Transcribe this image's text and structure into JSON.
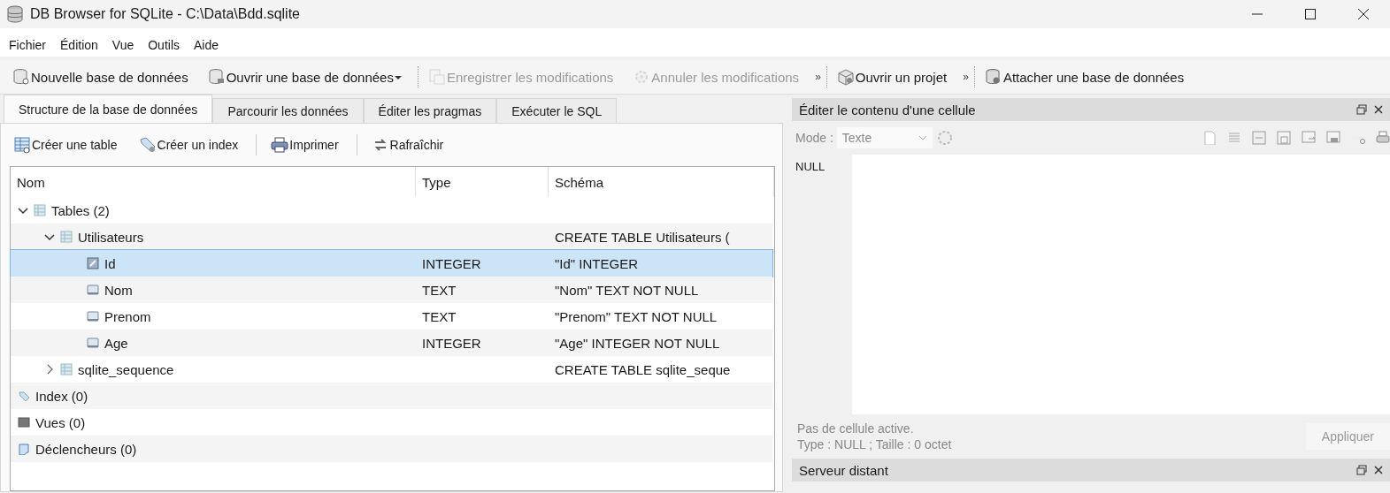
{
  "window": {
    "title": "DB Browser for SQLite - C:\\Data\\Bdd.sqlite"
  },
  "menu": [
    "Fichier",
    "Édition",
    "Vue",
    "Outils",
    "Aide"
  ],
  "toolbar": [
    {
      "kind": "button",
      "label": "Nouvelle base de données",
      "disabled": false
    },
    {
      "kind": "button",
      "label": "Ouvrir une base de données",
      "disabled": false,
      "dropdown": true
    },
    {
      "kind": "button",
      "label": "Enregistrer les modifications",
      "disabled": true
    },
    {
      "kind": "button",
      "label": "Annuler les modifications",
      "disabled": true
    },
    {
      "kind": "overflow",
      "label": "»"
    },
    {
      "kind": "button",
      "label": "Ouvrir un projet",
      "disabled": false
    },
    {
      "kind": "overflow",
      "label": "»"
    },
    {
      "kind": "button",
      "label": "Attacher une base de données",
      "disabled": false
    }
  ],
  "tabs": [
    {
      "label": "Structure de la base de données",
      "selected": true
    },
    {
      "label": "Parcourir les données",
      "selected": false
    },
    {
      "label": "Éditer les pragmas",
      "selected": false
    },
    {
      "label": "Exécuter le SQL",
      "selected": false
    }
  ],
  "structure_toolbar": [
    {
      "label": "Créer une table"
    },
    {
      "label": "Créer un index"
    },
    {
      "label": "Imprimer"
    },
    {
      "label": "Rafraîchir"
    }
  ],
  "tree": {
    "columns": [
      "Nom",
      "Type",
      "Schéma"
    ],
    "rows": [
      {
        "kind": "group",
        "name": "Tables (2)",
        "expanded": true,
        "selected": false,
        "children": [
          {
            "kind": "table",
            "name": "Utilisateurs",
            "schema": "CREATE TABLE Utilisateurs (",
            "expanded": true,
            "selected": false,
            "children": [
              {
                "kind": "key",
                "name": "Id",
                "type": "INTEGER",
                "schema": "\"Id\" INTEGER",
                "selected": true
              },
              {
                "kind": "field",
                "name": "Nom",
                "type": "TEXT",
                "schema": "\"Nom\" TEXT NOT NULL",
                "selected": false
              },
              {
                "kind": "field",
                "name": "Prenom",
                "type": "TEXT",
                "schema": "\"Prenom\" TEXT NOT NULL",
                "selected": false
              },
              {
                "kind": "field",
                "name": "Age",
                "type": "INTEGER",
                "schema": "\"Age\" INTEGER NOT NULL",
                "selected": false
              }
            ]
          },
          {
            "kind": "table",
            "name": "sqlite_sequence",
            "schema": "CREATE TABLE sqlite_seque",
            "expanded": false,
            "selected": false
          }
        ]
      },
      {
        "kind": "index",
        "name": "Index (0)",
        "selected": false
      },
      {
        "kind": "view",
        "name": "Vues (0)",
        "selected": false
      },
      {
        "kind": "trigger",
        "name": "Déclencheurs (0)",
        "selected": false
      }
    ]
  },
  "cell_editor": {
    "title": "Éditer le contenu d'une cellule",
    "mode_label": "Mode :",
    "mode": "Texte",
    "null_label": "NULL",
    "status": "Pas de cellule active.",
    "info": "Type : NULL ; Taille : 0 octet",
    "apply": "Appliquer",
    "apply_disabled": true
  },
  "remote_panel": {
    "title": "Serveur distant"
  }
}
